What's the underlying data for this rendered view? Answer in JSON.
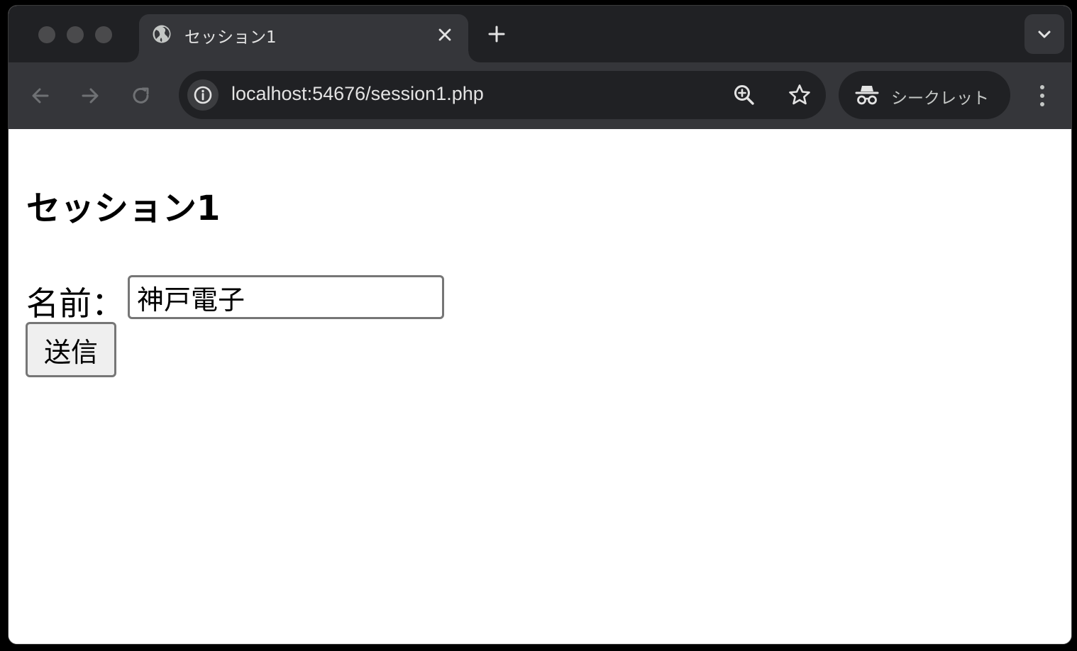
{
  "browser": {
    "tab": {
      "title": "セッション1",
      "favicon": "globe-icon"
    },
    "address_bar": {
      "url": "localhost:54676/session1.php"
    },
    "profile": {
      "label": "シークレット",
      "icon": "incognito-icon"
    },
    "colors": {
      "tabstrip": "#202124",
      "toolbar": "#35363a",
      "text": "#e3e3e3"
    }
  },
  "page": {
    "heading": "セッション1",
    "form": {
      "name_label": "名前：",
      "name_value": "神戸電子",
      "submit_label": "送信"
    }
  }
}
